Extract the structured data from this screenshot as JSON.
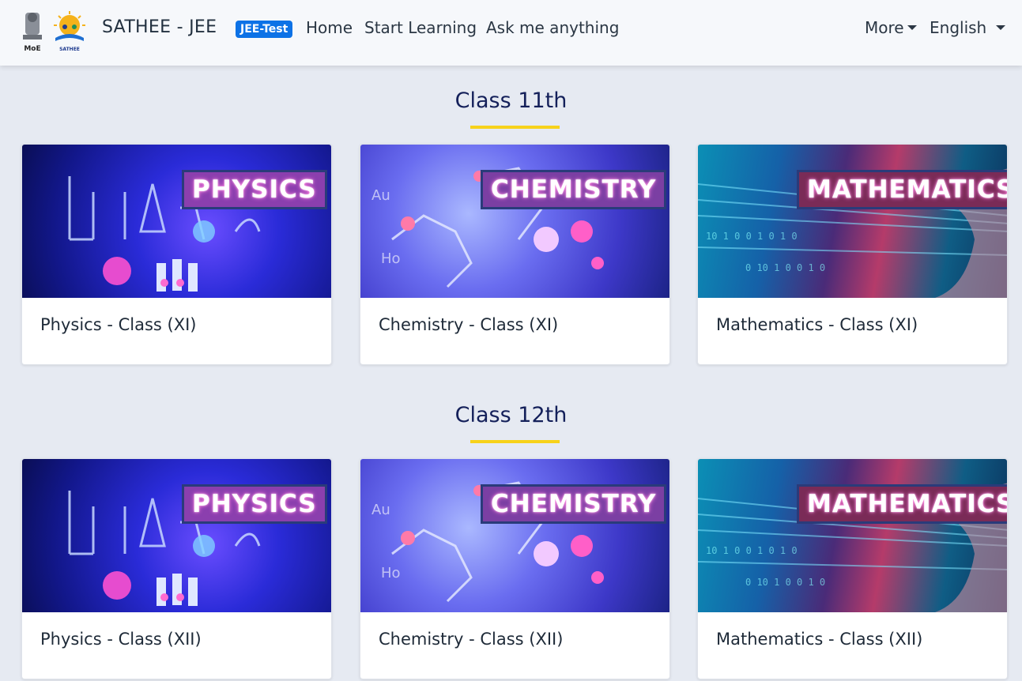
{
  "nav": {
    "logo_moe_text": "MoE",
    "logo_sathee_text": "SATHEE",
    "brand": "SATHEE - JEE",
    "badge": "JEE-Test",
    "links": [
      "Home",
      "Start Learning",
      "Ask me anything"
    ],
    "more": "More",
    "language": "English"
  },
  "sections": [
    {
      "title": "Class 11th",
      "cards": [
        {
          "tag": "PHYSICS",
          "title": "Physics - Class (XI)"
        },
        {
          "tag": "CHEMISTRY",
          "title": "Chemistry - Class (XI)"
        },
        {
          "tag": "MATHEMATICS",
          "title": "Mathematics - Class (XI)"
        }
      ]
    },
    {
      "title": "Class 12th",
      "cards": [
        {
          "tag": "PHYSICS",
          "title": "Physics - Class (XII)"
        },
        {
          "tag": "CHEMISTRY",
          "title": "Chemistry - Class (XII)"
        },
        {
          "tag": "MATHEMATICS",
          "title": "Mathematics - Class (XII)"
        }
      ]
    }
  ],
  "colors": {
    "accent_underline": "#f7d21b",
    "badge": "#0d72e6",
    "title": "#14205a"
  }
}
